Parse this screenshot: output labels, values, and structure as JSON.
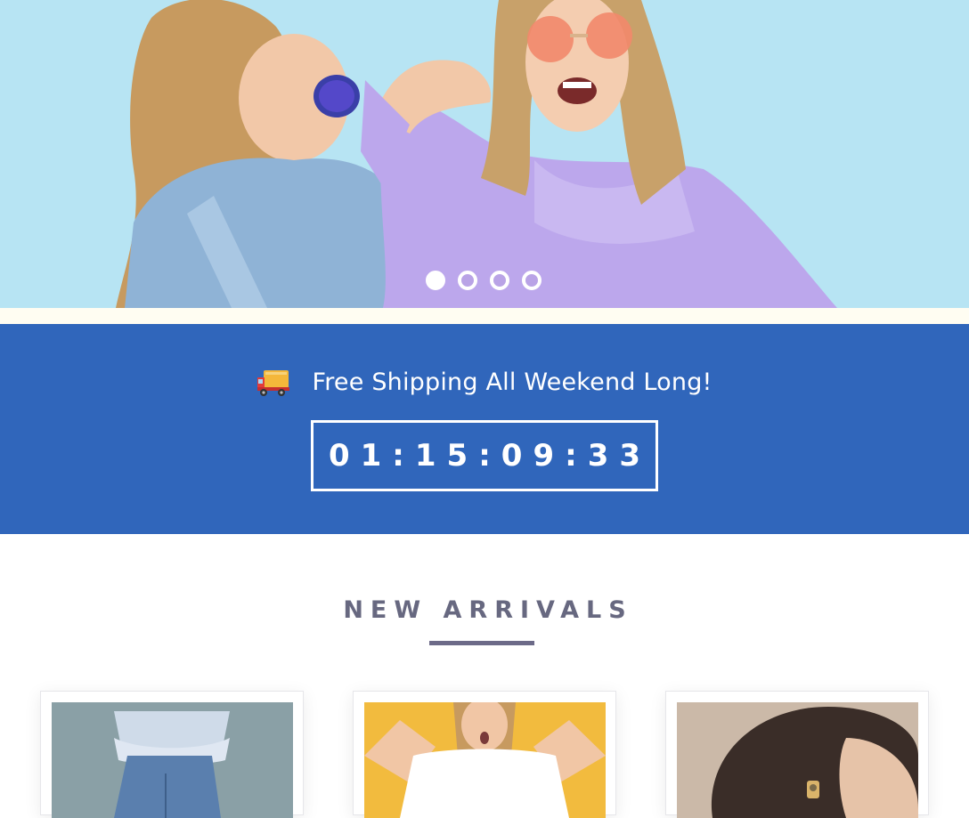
{
  "hero": {
    "slides_count": 4,
    "active_slide": 1
  },
  "promo": {
    "icon": "delivery-truck-icon",
    "text": "Free Shipping All Weekend Long!",
    "countdown": "01:15:09:33"
  },
  "new_arrivals": {
    "title": "NEW ARRIVALS",
    "products": [
      {
        "image": "woman-in-ruffle-top-and-jeans"
      },
      {
        "image": "woman-in-white-tshirt-yellow-background"
      },
      {
        "image": "woman-with-earring-closeup"
      }
    ]
  },
  "colors": {
    "hero_bg": "#b9e6f4",
    "promo_bg": "#3066bb",
    "title_text": "#676880"
  }
}
